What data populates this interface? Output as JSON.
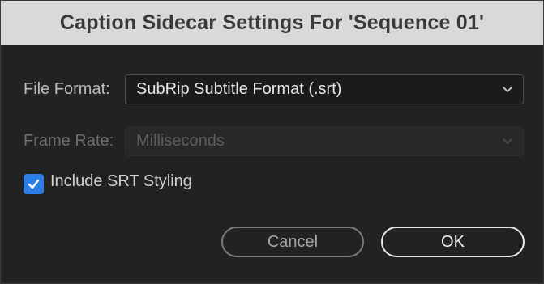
{
  "dialog": {
    "title": "Caption Sidecar Settings For 'Sequence 01'"
  },
  "file_format": {
    "label": "File Format:",
    "value": "SubRip Subtitle Format (.srt)",
    "enabled": true
  },
  "frame_rate": {
    "label": "Frame Rate:",
    "value": "Milliseconds",
    "enabled": false
  },
  "include_srt_styling": {
    "label": "Include SRT Styling",
    "checked": true
  },
  "buttons": {
    "cancel_label": "Cancel",
    "ok_label": "OK"
  },
  "icons": {
    "dropdown": "chevron-down-icon",
    "checkbox": "checkmark-icon"
  },
  "colors": {
    "accent": "#2d7de6",
    "title_bar": "#d9d9d9",
    "dialog_bg": "#222222"
  }
}
